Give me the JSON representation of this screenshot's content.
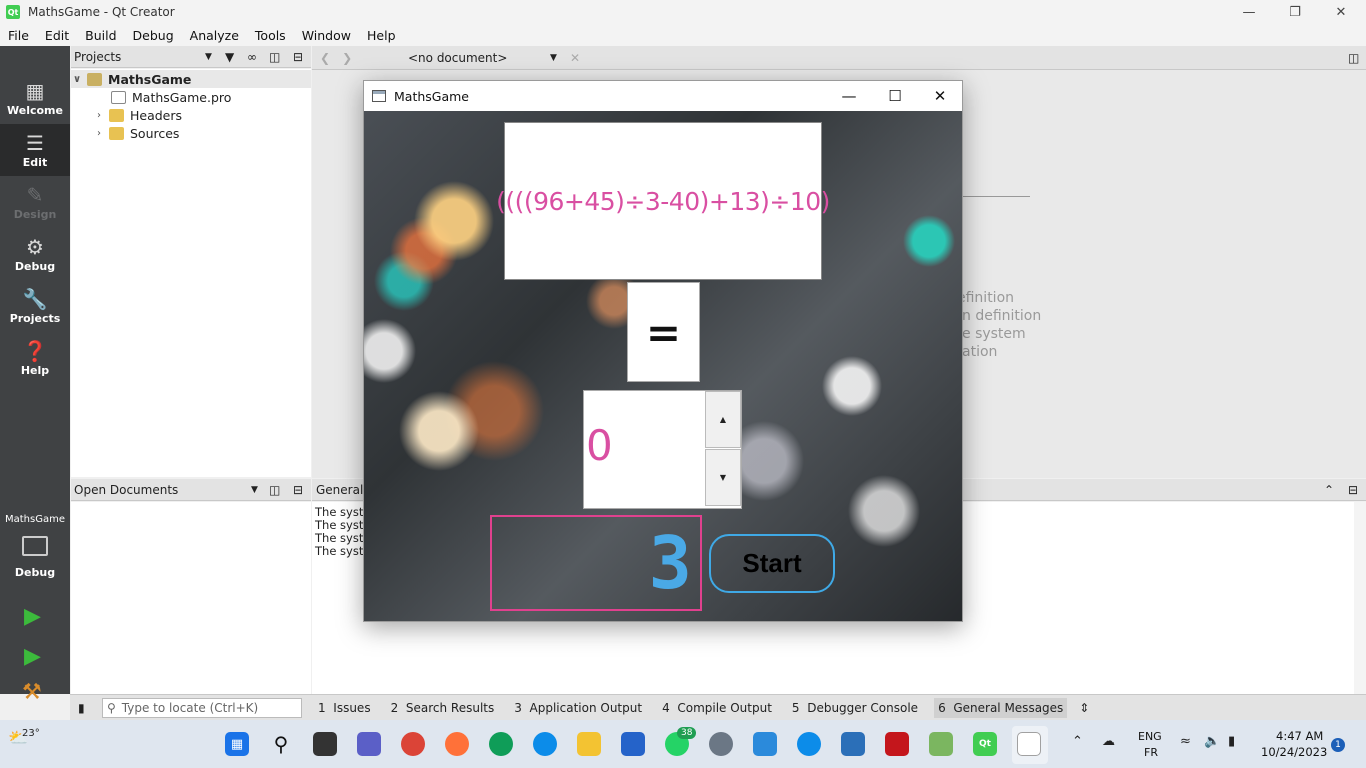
{
  "window": {
    "title": "MathsGame - Qt Creator",
    "icon_label": "Qt"
  },
  "menu": [
    "File",
    "Edit",
    "Build",
    "Debug",
    "Analyze",
    "Tools",
    "Window",
    "Help"
  ],
  "modes": [
    {
      "label": "Welcome",
      "icon": "grid-icon"
    },
    {
      "label": "Edit",
      "icon": "edit-icon"
    },
    {
      "label": "Design",
      "icon": "design-icon"
    },
    {
      "label": "Debug",
      "icon": "debug-icon"
    },
    {
      "label": "Projects",
      "icon": "wrench-icon"
    },
    {
      "label": "Help",
      "icon": "help-icon"
    }
  ],
  "projects_panel": {
    "title": "Projects",
    "tree": [
      {
        "label": "MathsGame",
        "expanded": true
      },
      {
        "label": "MathsGame.pro"
      },
      {
        "label": "Headers"
      },
      {
        "label": "Sources"
      }
    ]
  },
  "editor": {
    "document_selector": "<no document>",
    "ghost_lines": [
      "efinition",
      "n definition",
      "e system",
      "ation"
    ]
  },
  "open_documents": {
    "title": "Open Documents"
  },
  "general_messages": {
    "title": "General M",
    "lines": [
      "The syste",
      "The syste",
      "The syste",
      "The syste"
    ]
  },
  "kit": {
    "project": "MathsGame",
    "mode": "Debug"
  },
  "statusbar": {
    "locator_placeholder": "Type to locate (Ctrl+K)",
    "tabs": [
      {
        "num": "1",
        "label": "Issues"
      },
      {
        "num": "2",
        "label": "Search Results"
      },
      {
        "num": "3",
        "label": "Application Output"
      },
      {
        "num": "4",
        "label": "Compile Output"
      },
      {
        "num": "5",
        "label": "Debugger Console"
      },
      {
        "num": "6",
        "label": "General Messages"
      }
    ]
  },
  "game": {
    "title": "MathsGame",
    "expression": "((((96+45)÷3-40)+13)÷10)",
    "equals": "=",
    "answer_value": "0",
    "lcd_value": "3",
    "start_label": "Start"
  },
  "taskbar": {
    "weather_temp": "23°",
    "whatsapp_badge": "38",
    "lang": "ENG",
    "lang_sub": "FR",
    "time": "4:47 AM",
    "date": "10/24/2023",
    "notif": "1"
  },
  "colors": {
    "expression": "#d94fa2",
    "lcd": "#4aa9e6",
    "lcd_border": "#e0418e",
    "start_border": "#3fa9e6",
    "modebar": "#404244"
  }
}
